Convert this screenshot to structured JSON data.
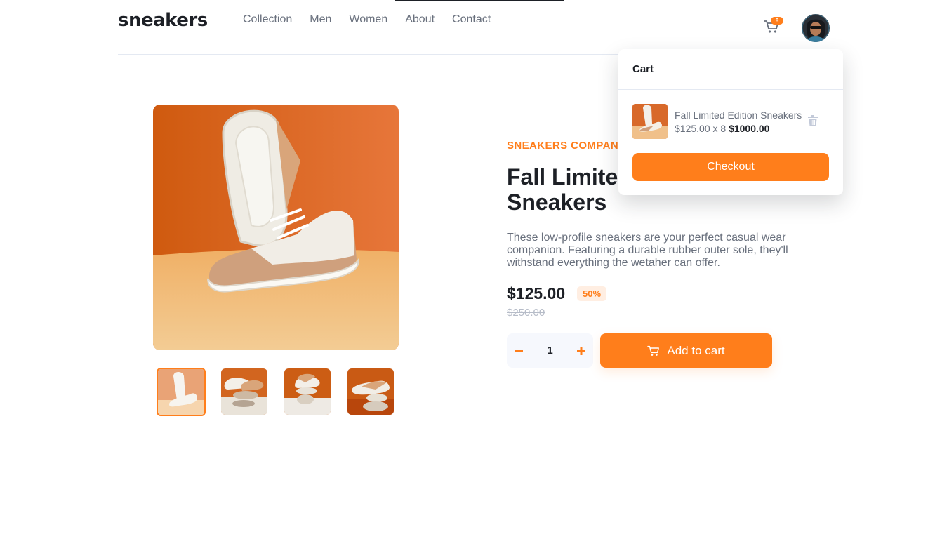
{
  "brand": {
    "logo": "sneakers"
  },
  "nav": [
    {
      "label": "Collection"
    },
    {
      "label": "Men"
    },
    {
      "label": "Women"
    },
    {
      "label": "About"
    },
    {
      "label": "Contact"
    }
  ],
  "header": {
    "cart_count": "8",
    "cart_icon": "cart-icon",
    "avatar_icon": "avatar"
  },
  "product": {
    "company": "SNEAKERS COMPANY",
    "title": "Fall Limited Edition Sneakers",
    "description": "These low-profile sneakers are your perfect casual wear companion. Featuring a durable rubber outer sole, they'll withstand everything the wetaher can offer.",
    "price": "$125.00",
    "discount": "50%",
    "original_price": "$250.00",
    "quantity": "1",
    "add_to_cart_label": "Add to cart"
  },
  "gallery": {
    "thumbnail_count": 4,
    "active_thumbnail": 1
  },
  "cart": {
    "title": "Cart",
    "item": {
      "name": "Fall Limited Edition Sneakers",
      "unit_line": "$125.00 x 8",
      "total": "$1000.00"
    },
    "checkout_label": "Checkout"
  },
  "colors": {
    "accent": "#ff7e1b",
    "accent_pale": "#ffeee2",
    "text_dark": "#1d2026",
    "text_gray": "#69707d",
    "text_light": "#b6bcc8"
  }
}
